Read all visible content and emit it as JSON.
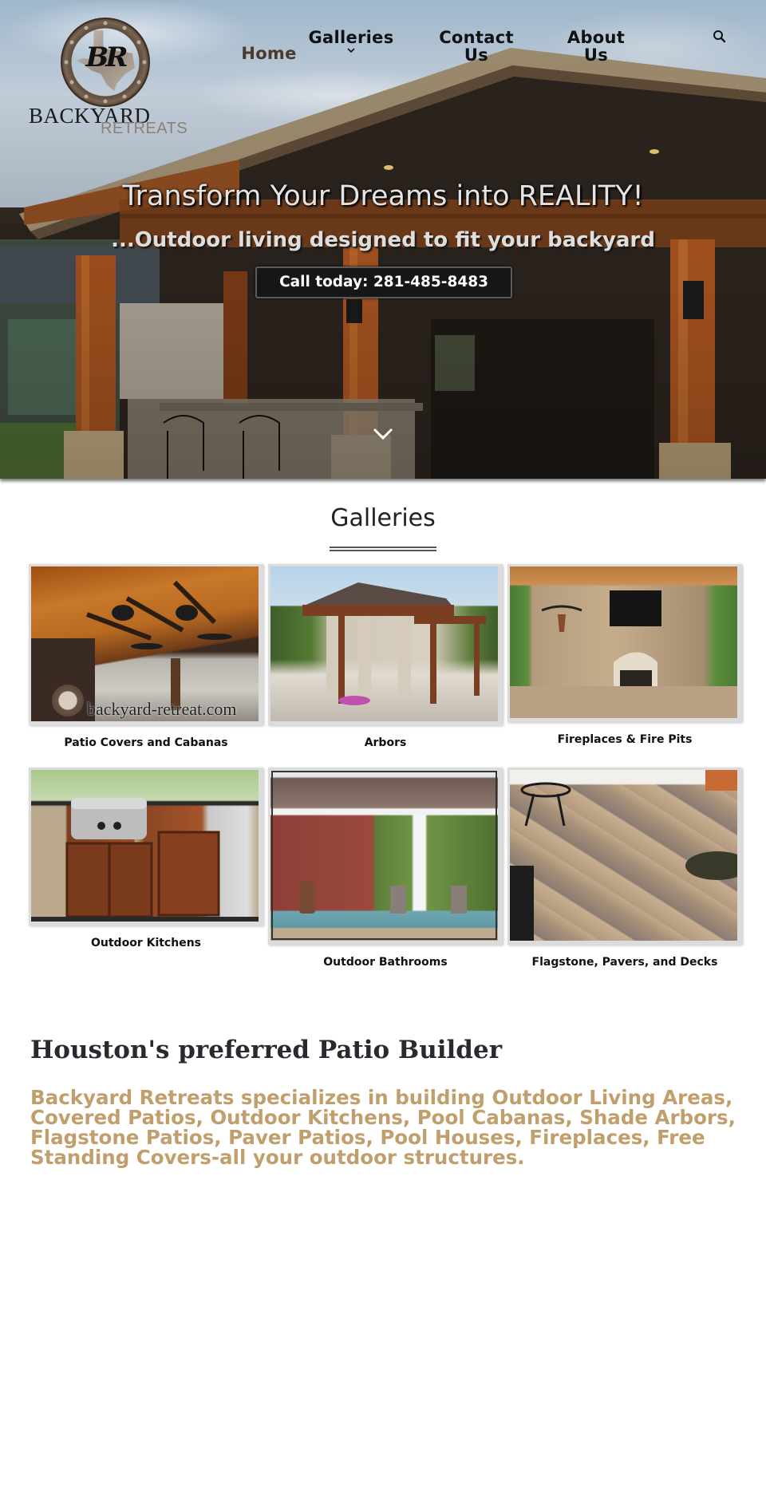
{
  "brand": {
    "monogram": "BR",
    "name_line1": "BACKYARD",
    "name_line2": "RETREATS"
  },
  "nav": {
    "items": [
      {
        "label": "Home",
        "active": true
      },
      {
        "label": "Galleries",
        "has_dropdown": true
      },
      {
        "label": "Contact Us"
      },
      {
        "label": "About Us"
      }
    ],
    "search_icon": "search-icon",
    "dropdown_icon": "chevron-down-icon"
  },
  "hero": {
    "title": "Transform Your Dreams into REALITY!",
    "subtitle": "...Outdoor living designed to fit your backyard",
    "cta_label": "Call today: 281-485-8483",
    "scroll_icon": "chevron-down-icon"
  },
  "galleries": {
    "title": "Galleries",
    "items": [
      {
        "label": "Patio Covers and Cabanas",
        "watermark": "backyard-retreat.com"
      },
      {
        "label": "Arbors"
      },
      {
        "label": "Fireplaces & Fire Pits"
      },
      {
        "label": "Outdoor Kitchens"
      },
      {
        "label": "Outdoor Bathrooms"
      },
      {
        "label": "Flagstone, Pavers, and Decks"
      }
    ]
  },
  "about": {
    "title": "Houston's preferred Patio Builder",
    "body": "Backyard Retreats specializes in building Outdoor Living Areas, Covered Patios, Outdoor Kitchens, Pool Cabanas, Shade Arbors, Flagstone Patios, Paver Patios, Pool Houses, Fireplaces, Free Standing Covers-all your outdoor structures."
  },
  "colors": {
    "accent_gold": "#c19f6c",
    "heading_dark": "#272a2e",
    "nav_active": "#4a3a2c",
    "cta_bg": "#141617"
  }
}
